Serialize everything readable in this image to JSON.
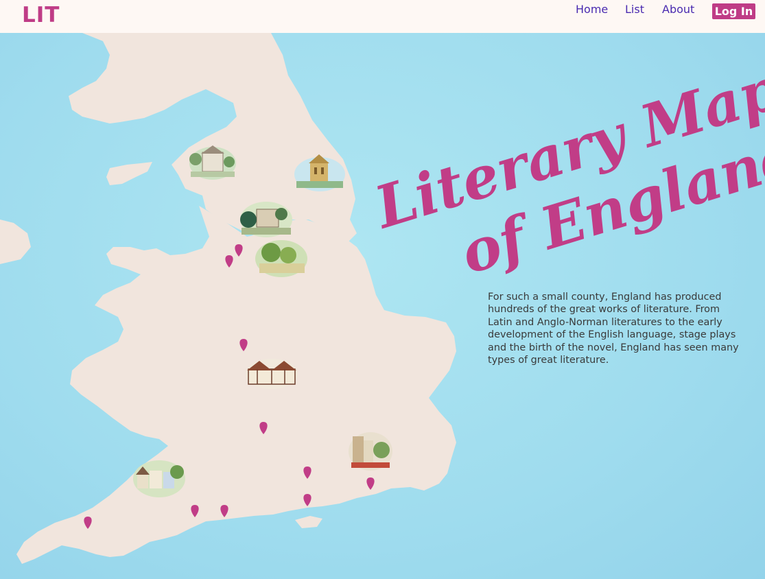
{
  "header": {
    "logo": "LIT",
    "nav": {
      "home": "Home",
      "list": "List",
      "about": "About"
    },
    "login": "Log In"
  },
  "map": {
    "title_line1": "Literary Map",
    "title_line2": "of England",
    "description": "For such a small county, England has produced hundreds of the great works of literature. From Latin and Anglo-Norman literatures to the early development of the English language, stage plays and the birth of the novel, England has seen many types of great literature.",
    "colors": {
      "sea": "#a5e0ef",
      "land": "#f1e5dd",
      "accent": "#c13d87"
    },
    "marker_count": 11,
    "illustration_count": 8
  }
}
